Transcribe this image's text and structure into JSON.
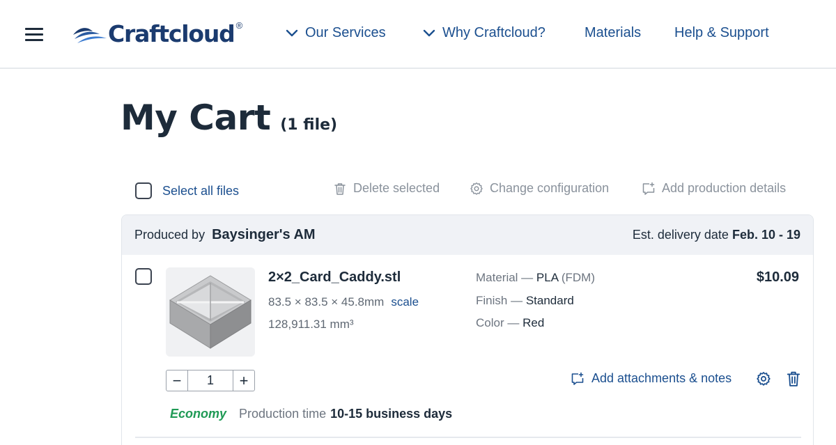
{
  "header": {
    "brand": "Craftcloud",
    "brand_mark": "®",
    "nav": {
      "services": "Our Services",
      "why": "Why Craftcloud?",
      "materials": "Materials",
      "help": "Help & Support"
    }
  },
  "page": {
    "title": "My Cart",
    "file_count": "(1 file)"
  },
  "actions": {
    "select_all": "Select all files",
    "delete_selected": "Delete selected",
    "change_configuration": "Change configuration",
    "add_production_details": "Add production details"
  },
  "vendor": {
    "produced_by_label": "Produced by",
    "name": "Baysinger's AM",
    "delivery_label": "Est. delivery date",
    "delivery_range": "Feb. 10 - 19"
  },
  "item": {
    "filename": "2×2_Card_Caddy.stl",
    "dimensions": "83.5 × 83.5 × 45.8mm",
    "scale_label": "scale",
    "volume": "128,911.31 mm³",
    "material_label": "Material —",
    "material": "PLA",
    "material_type": "(FDM)",
    "finish_label": "Finish —",
    "finish": "Standard",
    "color_label": "Color —",
    "color": "Red",
    "price": "$10.09",
    "quantity": "1",
    "qty_minus": "−",
    "qty_plus": "+",
    "add_attachments": "Add attachments & notes",
    "shipping_tier": "Economy",
    "production_label": "Production time",
    "production_time": "10-15 business days"
  },
  "colors": {
    "brand_navy": "#1b3b6f",
    "link_blue": "#1b4f8f",
    "economy_green": "#1f9a55",
    "card_header_bg": "#f0f2f6"
  },
  "icons": [
    "menu-icon",
    "craftcloud-logo-icon",
    "chevron-down-icon",
    "trash-icon",
    "gear-icon",
    "add-note-icon"
  ]
}
